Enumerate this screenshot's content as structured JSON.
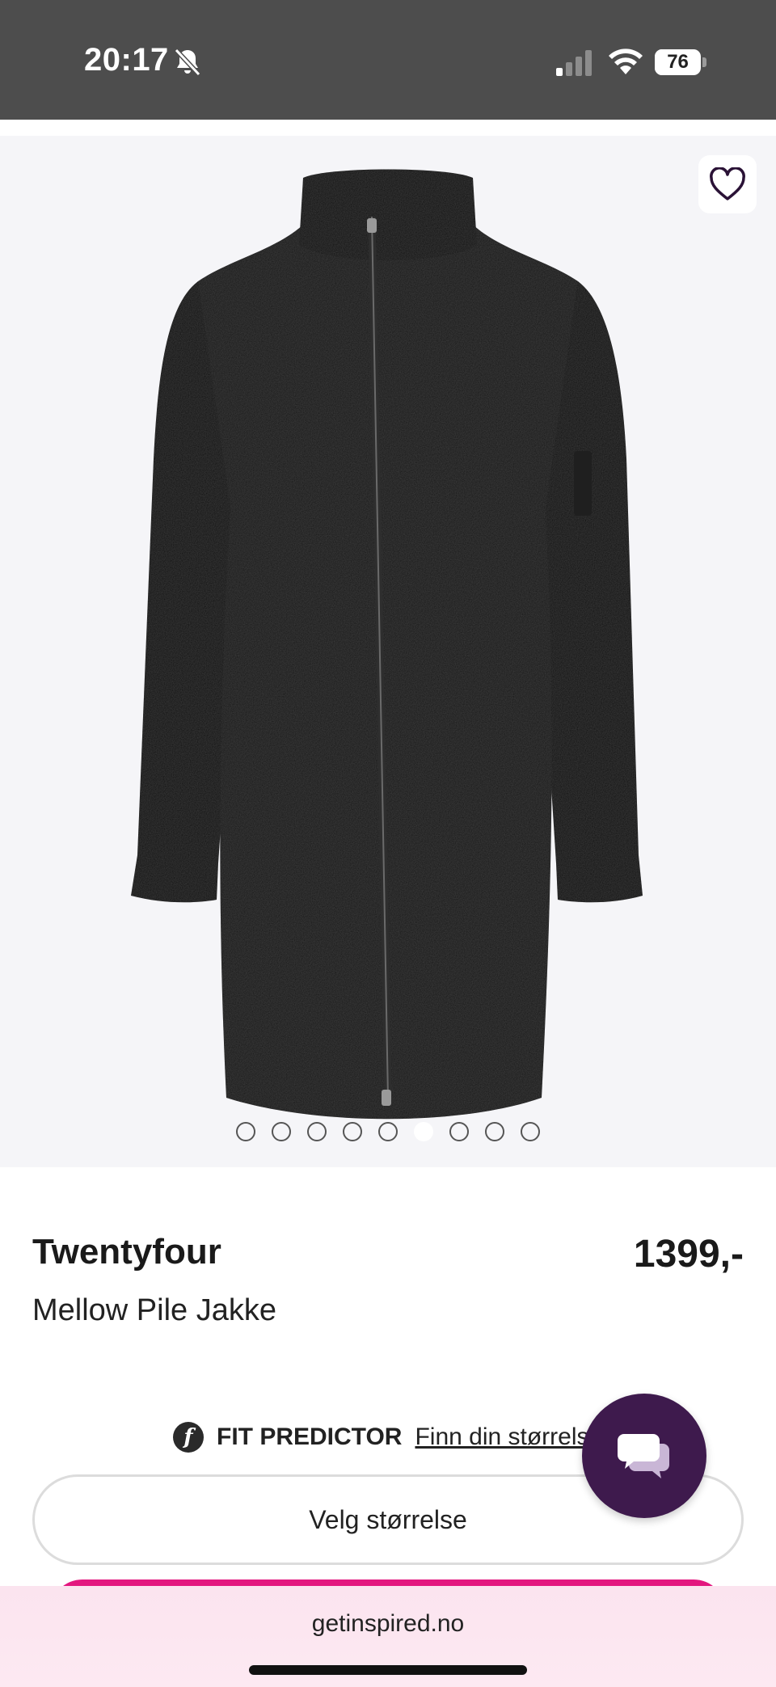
{
  "status_bar": {
    "time": "20:17",
    "battery": "76",
    "battery_fraction": 0.76,
    "icons": [
      "bell-slash-icon",
      "signal-icon",
      "wifi-icon",
      "battery-icon"
    ]
  },
  "product_image": {
    "favorite_icon": "heart-outline-icon",
    "carousel": {
      "total": 9,
      "active_index": 5
    }
  },
  "product": {
    "brand": "Twentyfour",
    "price": "1399,-",
    "name": "Mellow Pile Jakke"
  },
  "fit_predictor": {
    "logo_letter": "f",
    "label": "FIT PREDICTOR",
    "link": "Finn din størrelse"
  },
  "size_select": {
    "label": "Velg størrelse"
  },
  "chat": {
    "icon": "chat-bubbles-icon"
  },
  "browser": {
    "url": "getinspired.no"
  },
  "colors": {
    "accent": "#e3177f",
    "chat_bg": "#3e1a4d"
  }
}
